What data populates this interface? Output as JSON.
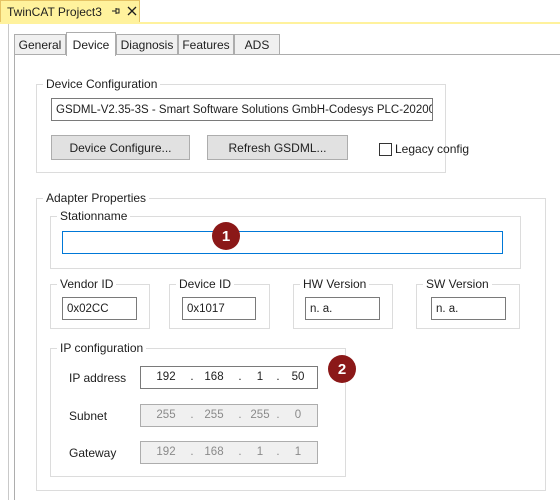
{
  "document_tab": {
    "title": "TwinCAT Project3",
    "pin_icon": "pin-icon",
    "close_icon": "close-icon"
  },
  "tabs": [
    {
      "label": "General"
    },
    {
      "label": "Device"
    },
    {
      "label": "Diagnosis"
    },
    {
      "label": "Features"
    },
    {
      "label": "ADS"
    }
  ],
  "device_config": {
    "legend": "Device Configuration",
    "gsdml_value": "GSDML-V2.35-3S - Smart Software Solutions GmbH-Codesys PLC-20200",
    "configure_button": "Device Configure...",
    "refresh_button": "Refresh GSDML...",
    "legacy_label": "Legacy config",
    "legacy_checked": false
  },
  "adapter": {
    "legend": "Adapter Properties",
    "stationname_legend": "Stationname",
    "stationname_value": "",
    "vendor": {
      "legend": "Vendor ID",
      "value": "0x02CC"
    },
    "device": {
      "legend": "Device ID",
      "value": "0x1017"
    },
    "hw": {
      "legend": "HW Version",
      "value": "n. a."
    },
    "sw": {
      "legend": "SW Version",
      "value": "n. a."
    },
    "ip": {
      "legend": "IP configuration",
      "address_label": "IP address",
      "address": [
        "192",
        "168",
        "1",
        "50"
      ],
      "subnet_label": "Subnet",
      "subnet": [
        "255",
        "255",
        "255",
        "0"
      ],
      "gateway_label": "Gateway",
      "gateway": [
        "192",
        "168",
        "1",
        "1"
      ]
    }
  },
  "markers": {
    "one": "1",
    "two": "2",
    "color": "#8b1818"
  }
}
